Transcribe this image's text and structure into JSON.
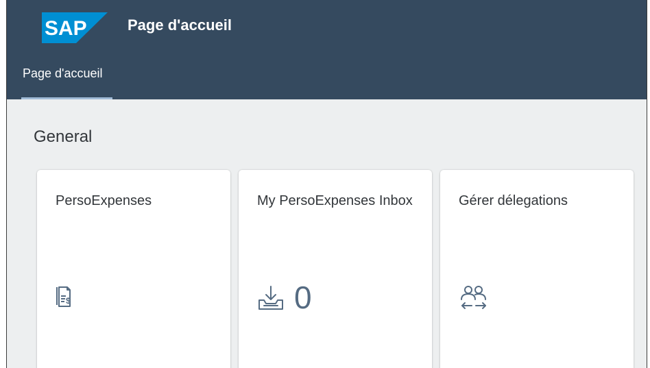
{
  "header": {
    "logo_text": "SAP",
    "title": "Page d'accueil",
    "brand_color": "#008fd3",
    "background": "#354a5f"
  },
  "tabs": [
    {
      "label": "Page d'accueil",
      "selected": true
    }
  ],
  "section": {
    "title": "General"
  },
  "tiles": [
    {
      "title": "PersoExpenses",
      "icon": "expense-report-icon"
    },
    {
      "title": "My PersoExpenses Inbox",
      "icon": "inbox-download-icon",
      "count": "0"
    },
    {
      "title": "Gérer délegations",
      "icon": "delegation-users-icon"
    }
  ]
}
